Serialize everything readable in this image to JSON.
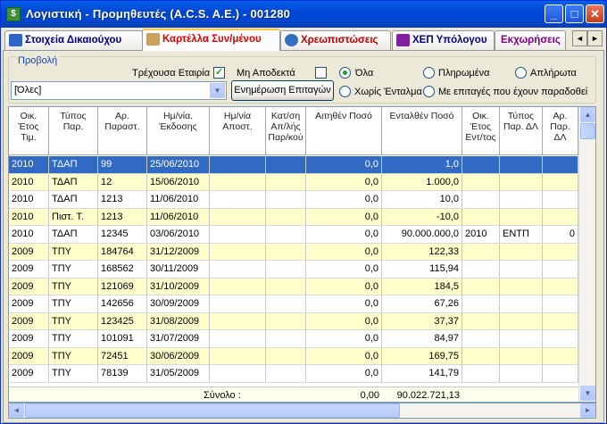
{
  "window": {
    "title": "Λογιστική - Προμηθευτές  (A.C.S. A.E.)  -  001280",
    "app_icon_glyph": "$",
    "minimize": "_",
    "maximize": "□",
    "close": "✕"
  },
  "tabs": [
    {
      "label": "Στοιχεία Δικαιούχου",
      "color": "#000080",
      "icon": "people-icon",
      "icon_color": "#2E64C8"
    },
    {
      "label": "Καρτέλλα Συν/μένου",
      "color": "#E00000",
      "icon": "ledger-icon",
      "icon_color": "#C8A060"
    },
    {
      "label": "Χρεωπιστώσεις",
      "color": "#C00000",
      "icon": "globe-icon",
      "icon_color": "#3070C0"
    },
    {
      "label": "ΧΕΠ Υπόλογου",
      "color": "#000080",
      "icon": "film-icon",
      "icon_color": "#8020A0"
    },
    {
      "label": "Εκχωρήσεις",
      "color": "#800080",
      "icon": "",
      "icon_color": ""
    }
  ],
  "tab_scroll": {
    "left": "◄",
    "right": "►"
  },
  "filters": {
    "group_title": "Προβολή",
    "current_company_label": "Τρέχουσα Εταιρία",
    "current_company_checked": "✓",
    "unaccepted_label": "Μη Αποδεκτά",
    "unaccepted_checked": "",
    "radio_all": "Όλα",
    "radio_paid": "Πληρωμένα",
    "radio_unpaid": "Απλήρωτα",
    "radio_no_order": "Χωρίς Ένταλμα",
    "radio_with_checks": "Με επιταγές που έχουν παραδοθεί",
    "combo_value": "[Όλες]",
    "combo_arrow": "▼",
    "update_checks_button": "Ενημέρωση Επιταγών"
  },
  "table": {
    "headers": [
      "Οικ.\nΈτος\nΤιμ.",
      "Τύπος\nΠαρ.",
      "Αρ.\nΠαραστ.",
      "Ημ/νία.\nΈκδοσης",
      "Ημ/νία\nΑποστ.",
      "Κατ/ση\nΑπ/λής\nΠαρ/κού",
      "Αιτηθέν Ποσό",
      "Ενταλθέν Ποσό",
      "Οικ.\nΈτος\nΕντ/τος",
      "Τύπος\nΠαρ. ΔΛ",
      "Αρ. Παρ.\nΔΛ"
    ],
    "rows": [
      {
        "year": "2010",
        "type": "ΤΔΑΠ",
        "num": "99",
        "date": "25/06/2010",
        "sent": "",
        "status": "",
        "req": "0,0",
        "ord": "1,0",
        "oyear": "",
        "dltype": "",
        "dlnum": "",
        "bg": "sel"
      },
      {
        "year": "2010",
        "type": "ΤΔΑΠ",
        "num": "12",
        "date": "15/06/2010",
        "sent": "",
        "status": "",
        "req": "0,0",
        "ord": "1.000,0",
        "oyear": "",
        "dltype": "",
        "dlnum": "",
        "bg": "y"
      },
      {
        "year": "2010",
        "type": "ΤΔΑΠ",
        "num": "1213",
        "date": "11/06/2010",
        "sent": "",
        "status": "",
        "req": "0,0",
        "ord": "10,0",
        "oyear": "",
        "dltype": "",
        "dlnum": "",
        "bg": "w"
      },
      {
        "year": "2010",
        "type": "Πιστ. Τ.",
        "num": "1213",
        "date": "11/06/2010",
        "sent": "",
        "status": "",
        "req": "0,0",
        "ord": "-10,0",
        "oyear": "",
        "dltype": "",
        "dlnum": "",
        "bg": "y"
      },
      {
        "year": "2010",
        "type": "ΤΔΑΠ",
        "num": "12345",
        "date": "03/06/2010",
        "sent": "",
        "status": "",
        "req": "0,0",
        "ord": "90.000.000,0",
        "oyear": "2010",
        "dltype": "ΕΝΤΠ",
        "dlnum": "0",
        "bg": "w"
      },
      {
        "year": "2009",
        "type": "ΤΠΥ",
        "num": "184764",
        "date": "31/12/2009",
        "sent": "",
        "status": "",
        "req": "0,0",
        "ord": "122,33",
        "oyear": "",
        "dltype": "",
        "dlnum": "",
        "bg": "y"
      },
      {
        "year": "2009",
        "type": "ΤΠΥ",
        "num": "168562",
        "date": "30/11/2009",
        "sent": "",
        "status": "",
        "req": "0,0",
        "ord": "115,94",
        "oyear": "",
        "dltype": "",
        "dlnum": "",
        "bg": "w"
      },
      {
        "year": "2009",
        "type": "ΤΠΥ",
        "num": "121069",
        "date": "31/10/2009",
        "sent": "",
        "status": "",
        "req": "0,0",
        "ord": "184,5",
        "oyear": "",
        "dltype": "",
        "dlnum": "",
        "bg": "y"
      },
      {
        "year": "2009",
        "type": "ΤΠΥ",
        "num": "142656",
        "date": "30/09/2009",
        "sent": "",
        "status": "",
        "req": "0,0",
        "ord": "67,26",
        "oyear": "",
        "dltype": "",
        "dlnum": "",
        "bg": "w"
      },
      {
        "year": "2009",
        "type": "ΤΠΥ",
        "num": "123425",
        "date": "31/08/2009",
        "sent": "",
        "status": "",
        "req": "0,0",
        "ord": "37,37",
        "oyear": "",
        "dltype": "",
        "dlnum": "",
        "bg": "y"
      },
      {
        "year": "2009",
        "type": "ΤΠΥ",
        "num": "101091",
        "date": "31/07/2009",
        "sent": "",
        "status": "",
        "req": "0,0",
        "ord": "84,97",
        "oyear": "",
        "dltype": "",
        "dlnum": "",
        "bg": "w"
      },
      {
        "year": "2009",
        "type": "ΤΠΥ",
        "num": "72451",
        "date": "30/06/2009",
        "sent": "",
        "status": "",
        "req": "0,0",
        "ord": "169,75",
        "oyear": "",
        "dltype": "",
        "dlnum": "",
        "bg": "y"
      },
      {
        "year": "2009",
        "type": "ΤΠΥ",
        "num": "78139",
        "date": "31/05/2009",
        "sent": "",
        "status": "",
        "req": "0,0",
        "ord": "141,79",
        "oyear": "",
        "dltype": "",
        "dlnum": "",
        "bg": "w"
      }
    ],
    "total_label": "Σύνολο :",
    "total_requested": "0,00",
    "total_ordered": "90.022.721,13"
  },
  "colors": {
    "selected_row": "#316AC5",
    "alt_row": "#FFFFCC",
    "title_bar": "#0047D3"
  },
  "scroll": {
    "up": "▲",
    "down": "▼",
    "left": "◄",
    "right": "►"
  }
}
